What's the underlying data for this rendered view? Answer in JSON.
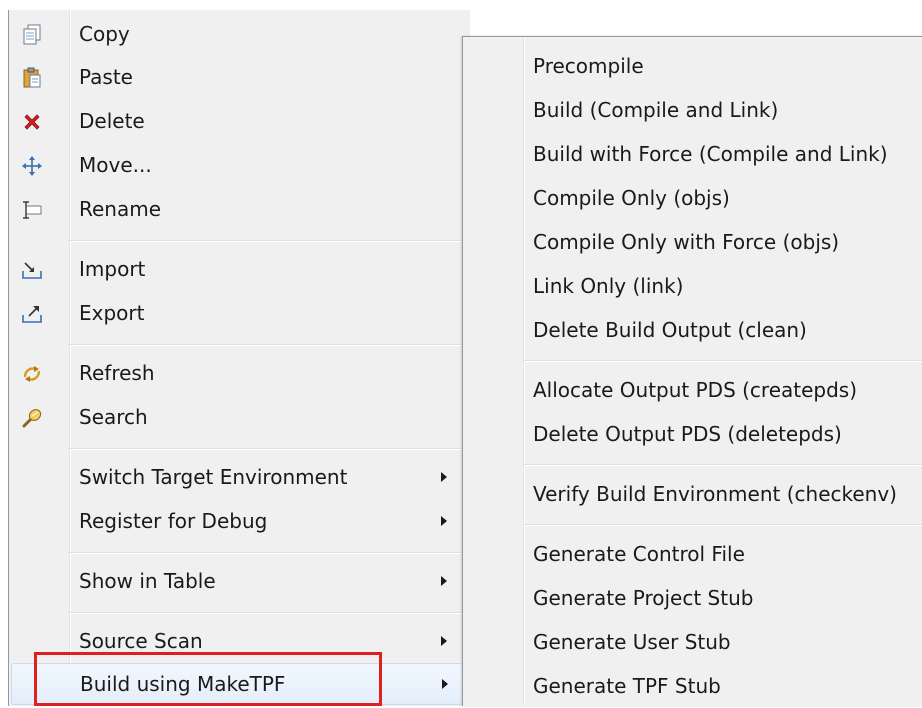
{
  "main_menu": {
    "items": [
      {
        "label": "Copy",
        "icon": "copy-icon"
      },
      {
        "label": "Paste",
        "icon": "paste-icon"
      },
      {
        "label": "Delete",
        "icon": "delete-icon"
      },
      {
        "label": "Move...",
        "icon": "move-icon"
      },
      {
        "label": "Rename",
        "icon": "rename-icon"
      },
      {
        "label": "Import",
        "icon": "import-icon"
      },
      {
        "label": "Export",
        "icon": "export-icon"
      },
      {
        "label": "Refresh",
        "icon": "refresh-icon"
      },
      {
        "label": "Search",
        "icon": "search-icon"
      },
      {
        "label": "Switch Target Environment",
        "has_submenu": true
      },
      {
        "label": "Register for Debug",
        "has_submenu": true
      },
      {
        "label": "Show in Table",
        "has_submenu": true
      },
      {
        "label": "Source Scan",
        "has_submenu": true
      },
      {
        "label": "Build using MakeTPF",
        "has_submenu": true,
        "highlighted": true
      }
    ]
  },
  "submenu": {
    "items": [
      "Precompile",
      "Build (Compile and Link)",
      "Build with Force (Compile and Link)",
      "Compile Only (objs)",
      "Compile Only with Force (objs)",
      "Link Only (link)",
      "Delete Build Output (clean)",
      "Allocate Output PDS (createpds)",
      "Delete Output PDS (deletepds)",
      "Verify Build Environment (checkenv)",
      "Generate Control File",
      "Generate Project Stub",
      "Generate User Stub",
      "Generate TPF Stub"
    ]
  },
  "colors": {
    "menu_bg": "#f0f0f0",
    "highlight_bg": "#e3eefa",
    "annotation_red": "#e02020",
    "delete_red": "#d62020"
  }
}
